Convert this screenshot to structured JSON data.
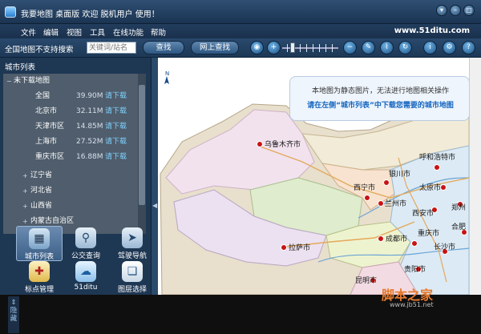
{
  "window": {
    "title": "我要地图 桌面版  欢迎 脱机用户 使用！",
    "controls": [
      "▾",
      "–",
      "□",
      "✕"
    ]
  },
  "menu": {
    "items": [
      "文件",
      "编辑",
      "视图",
      "工具",
      "在线功能",
      "帮助"
    ],
    "site": "www.51ditu.com"
  },
  "toolbar": {
    "search_label": "全国地图不支持搜索",
    "search_placeholder": "关键词/站名",
    "search_button": "查找",
    "online_search_button": "网上查找",
    "icons": [
      "globe-icon",
      "zoom-in-icon",
      "zoom-out-icon",
      "pen-icon",
      "ruler-icon",
      "refresh-icon",
      "info-icon",
      "settings-icon",
      "help-icon"
    ],
    "zoom_level_fraction": 0.12
  },
  "sidebar": {
    "header": "城市列表",
    "group_label": "未下载地图",
    "download_text": "请下载",
    "cities": [
      {
        "name": "全国",
        "size": "39.90M"
      },
      {
        "name": "北京市",
        "size": "32.11M"
      },
      {
        "name": "天津市区",
        "size": "14.85M"
      },
      {
        "name": "上海市",
        "size": "27.52M"
      },
      {
        "name": "重庆市区",
        "size": "16.88M"
      }
    ],
    "provinces": [
      "辽宁省",
      "河北省",
      "山西省",
      "内蒙古自治区"
    ]
  },
  "tools": [
    {
      "label": "城市列表",
      "icon": "city-list-icon",
      "selected": true
    },
    {
      "label": "公交查询",
      "icon": "bus-stop-icon",
      "selected": false
    },
    {
      "label": "驾驶导航",
      "icon": "navigation-icon",
      "selected": false
    },
    {
      "label": "标点管理",
      "icon": "pushpin-icon",
      "selected": false
    },
    {
      "label": "51ditu",
      "icon": "cloud-icon",
      "selected": false
    },
    {
      "label": "图层选择",
      "icon": "layers-icon",
      "selected": false
    }
  ],
  "map": {
    "info_line1": "本地图为静态图片，无法进行地图相关操作",
    "info_line2": "请在左侧“城市列表”中下载您需要的城市地图",
    "cities": [
      "乌鲁木齐市",
      "呼和浩特市",
      "银川市",
      "西宁市",
      "兰州市",
      "太原市",
      "西安市",
      "拉萨市",
      "成都市",
      "重庆市",
      "长沙市",
      "贵阳市",
      "昆明市",
      "合肥",
      "郑州"
    ]
  },
  "status": {
    "hide_label": "隐藏"
  },
  "watermark": {
    "brand": "脚本之家",
    "url": "www.jb51.net"
  },
  "colors": {
    "chrome": "#1e3753",
    "link": "#7fd2ff",
    "city_dot": "#c81414",
    "info_text": "#1565c0"
  }
}
